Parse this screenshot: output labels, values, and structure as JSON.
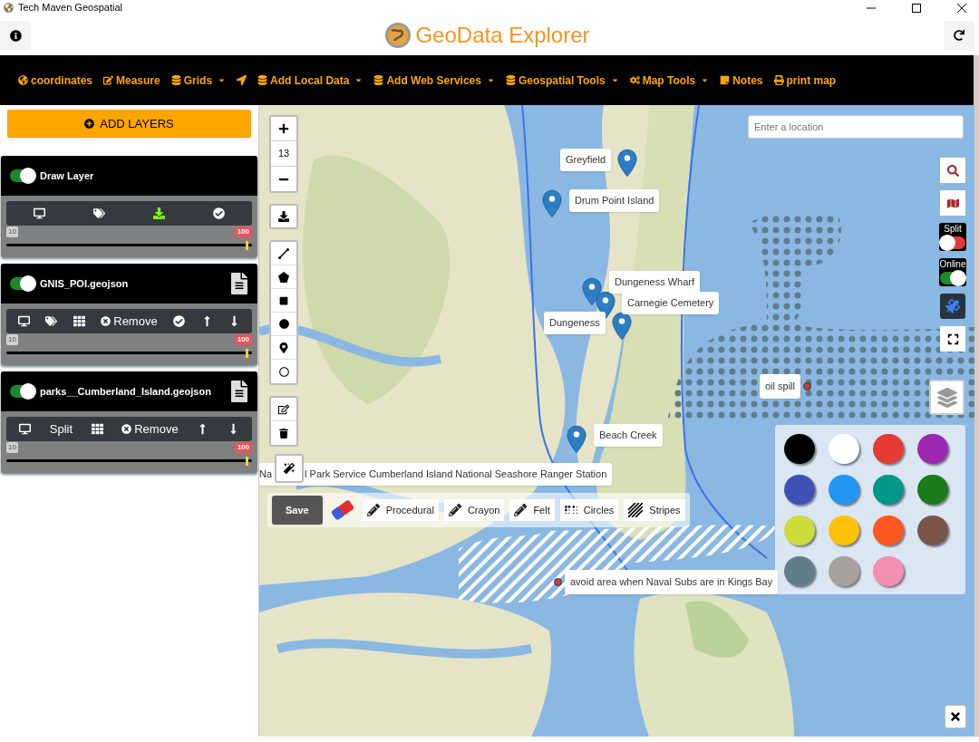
{
  "window": {
    "title": "Tech Maven Geospatial"
  },
  "header": {
    "title": "GeoData Explorer"
  },
  "menu": [
    {
      "label": "coordinates",
      "dropdown": false
    },
    {
      "label": "Measure",
      "dropdown": false
    },
    {
      "label": "Grids",
      "dropdown": true
    },
    {
      "dropdown": false
    },
    {
      "label": "Add Local Data",
      "dropdown": true
    },
    {
      "label": "Add Web Services",
      "dropdown": true
    },
    {
      "label": "Geospatial Tools",
      "dropdown": true
    },
    {
      "label": "Map Tools",
      "dropdown": true
    },
    {
      "label": "Notes",
      "dropdown": false
    },
    {
      "label": "print map",
      "dropdown": false
    }
  ],
  "sidebar": {
    "add_button": "ADD LAYERS",
    "layers": [
      {
        "name": "Draw Layer",
        "on": true,
        "file_icon": false,
        "min": "10",
        "max": "100",
        "level": 1,
        "tools": [
          {
            "kind": "monitor",
            "active": false
          },
          {
            "kind": "tags",
            "active": false
          },
          {
            "kind": "download",
            "active": true
          },
          {
            "kind": "check",
            "active": false
          }
        ]
      },
      {
        "name": "GNIS_POI.geojson",
        "on": true,
        "file_icon": true,
        "min": "10",
        "max": "100",
        "level": 1,
        "tools": [
          {
            "kind": "monitor",
            "active": false
          },
          {
            "kind": "tags",
            "active": false
          },
          {
            "kind": "table",
            "active": false
          },
          {
            "kind": "remove",
            "label": "Remove",
            "active": false
          },
          {
            "kind": "check",
            "active": false
          },
          {
            "kind": "up",
            "active": false
          },
          {
            "kind": "down",
            "active": false
          }
        ]
      },
      {
        "name": "parks__Cumberland_Island.geojson",
        "on": true,
        "file_icon": true,
        "min": "10",
        "max": "100",
        "level": 1,
        "tools": [
          {
            "kind": "monitor",
            "active": false
          },
          {
            "kind": "text",
            "label": "Split",
            "active": false
          },
          {
            "kind": "table",
            "active": false
          },
          {
            "kind": "remove",
            "label": "Remove",
            "active": false
          },
          {
            "kind": "up",
            "active": false
          },
          {
            "kind": "down",
            "active": false
          }
        ]
      }
    ]
  },
  "map": {
    "zoom": "13",
    "search": {
      "placeholder": "Enter a location"
    },
    "split": {
      "label": "Split",
      "on": false
    },
    "online": {
      "label": "Online",
      "on": true
    },
    "markers": [
      {
        "label": "Greyfield"
      },
      {
        "label": "Drum Point Island"
      },
      {
        "label": "Dungeness Wharf"
      },
      {
        "label": "Carnegie Cemetery"
      },
      {
        "label": "Dungeness"
      },
      {
        "label": "Beach Creek"
      }
    ],
    "ranger_label": [
      "Na",
      "l Park Service Cumberland Island National Seashore Ranger Station"
    ],
    "notes": [
      {
        "label": "oil spill"
      },
      {
        "label": "avoid area when Naval Subs are in Kings Bay"
      }
    ],
    "draw_toolbar": {
      "save": "Save",
      "brushes": [
        {
          "kind": "pencil",
          "label": "Procedural"
        },
        {
          "kind": "pencil",
          "label": "Crayon"
        },
        {
          "kind": "pencil",
          "label": "Felt"
        },
        {
          "kind": "circles",
          "label": "Circles"
        },
        {
          "kind": "stripes",
          "label": "Stripes"
        }
      ]
    },
    "palette": [
      {
        "color": "#000000"
      },
      {
        "color": "#ffffff"
      },
      {
        "color": "#e53935"
      },
      {
        "color": "#9c27b0"
      },
      {
        "color": "#3f51b5"
      },
      {
        "color": "#2196f3"
      },
      {
        "color": "#009688"
      },
      {
        "color": "#1b7a1b"
      },
      {
        "color": "#cddc39"
      },
      {
        "color": "#ffc107"
      },
      {
        "color": "#ff5722"
      },
      {
        "color": "#795548"
      },
      {
        "color": "#607d8b"
      },
      {
        "color": "#a8a29e"
      },
      {
        "color": "#f48fb1"
      }
    ]
  }
}
